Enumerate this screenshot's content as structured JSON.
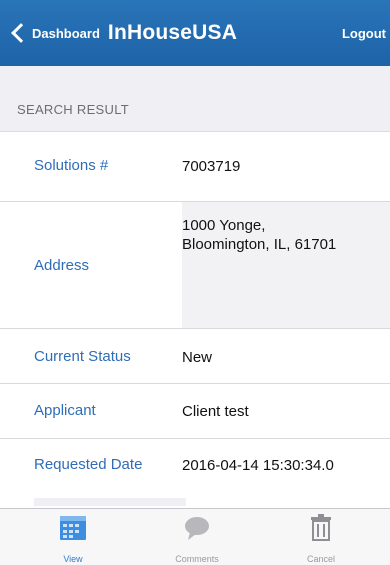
{
  "navbar": {
    "back_label": "Dashboard",
    "title": "InHouseUSA",
    "logout_label": "Logout",
    "bg_color": "#1f67ad"
  },
  "section": {
    "header": "SEARCH RESULT"
  },
  "rows": [
    {
      "label": "Solutions #",
      "value": "7003719"
    },
    {
      "label": "Address",
      "value_line1": "1000 Yonge,",
      "value_line2": "Bloomington, IL, 61701"
    },
    {
      "label": "Current Status",
      "value": "New"
    },
    {
      "label": "Applicant",
      "value": "Client test"
    },
    {
      "label": "Requested Date",
      "value": "2016-04-14 15:30:34.0"
    }
  ],
  "tabbar": {
    "tabs": [
      {
        "label": "View",
        "icon": "calendar-icon",
        "active": true
      },
      {
        "label": "Comments",
        "icon": "speech-bubble-icon",
        "active": false
      },
      {
        "label": "Cancel",
        "icon": "trash-icon",
        "active": false
      }
    ],
    "active_color": "#2f7fd3"
  }
}
